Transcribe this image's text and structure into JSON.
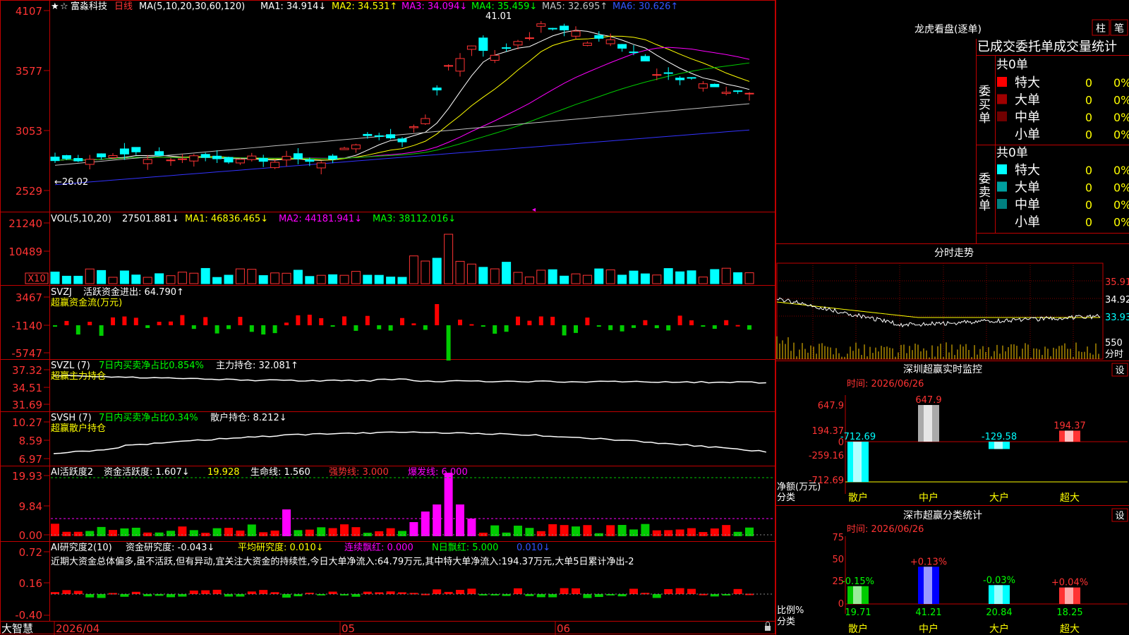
{
  "main": {
    "stock_name": "富淼科技",
    "period": "日线",
    "ma_prefix": "MA(5,10,20,30,60,120)",
    "ma_items": [
      {
        "text": "MA1: 34.914↓",
        "color": "#ffffff"
      },
      {
        "text": "MA2: 34.531↑",
        "color": "#ffff00"
      },
      {
        "text": "MA3: 34.094↓",
        "color": "#ff00ff"
      },
      {
        "text": "MA4: 35.459↓",
        "color": "#00ff00"
      },
      {
        "text": "MA5: 32.695↑",
        "color": "#c0c0c0"
      },
      {
        "text": "MA6: 30.626↑",
        "color": "#3333ff"
      }
    ],
    "price_ticks": [
      "4107",
      "3577",
      "3053",
      "2529"
    ],
    "high_label": "41.01",
    "low_label": "←26.02",
    "date_labels": [
      "2026/04",
      "05",
      "06"
    ]
  },
  "volume": {
    "title": "VOL(5,10,20)",
    "value": "27501.881↓",
    "ma1": "MA1: 46836.465↓",
    "ma2": "MA2: 44181.941↓",
    "ma3": "MA3: 38112.016↓",
    "ticks": [
      "21240",
      "10489"
    ],
    "unit": "X10"
  },
  "svzj": {
    "title": "SVZJ",
    "line1": "活跃资金进出: 64.790↑",
    "line2": "超赢资金流(万元)",
    "ticks": [
      "3467",
      "-1140",
      "-5747"
    ]
  },
  "svzl": {
    "title": "SVZL (7)",
    "pct": "7日内买卖净占比0.854%",
    "pos": "主力持仓: 32.081↑",
    "line2": "超赢主力持仓",
    "ticks": [
      "37.32",
      "34.51",
      "31.69"
    ]
  },
  "svsh": {
    "title": "SVSH (7)",
    "pct": "7日内买卖净占比0.34%",
    "pos": "散户持仓: 8.212↓",
    "line2": "超赢散户持仓",
    "ticks": [
      "10.27",
      "8.59",
      "6.97"
    ]
  },
  "ai1": {
    "title": "AI活跃度2",
    "act": "资金活跃度: 1.607↓",
    "v2": "19.928",
    "life": "生命线: 1.560",
    "strong": "强势线: 3.000",
    "burst": "爆发线: 6.000",
    "ticks": [
      "19.93",
      "9.84",
      "0.00"
    ]
  },
  "ai2": {
    "title": "AI研究度2(10)",
    "research": "资金研究度: -0.043↓",
    "avg": "平均研究度: 0.010↓",
    "lianxu": "连续飘红: 0.000",
    "nday": "N日飘红: 5.000",
    "v5": "0.010↓",
    "comment": "近期大资金总体偏多,虽不活跃,但有异动,宜关注大资金的持续性,今日大单净流入:64.79万元,其中特大单净流入:194.37万元,大单5日累计净出-2",
    "ticks": [
      "0.72",
      "0.16",
      "-0.40"
    ]
  },
  "bottom": {
    "brand": "大智慧"
  },
  "lhb": {
    "title": "龙虎看盘(逐单)",
    "btn1": "柱",
    "btn2": "笔",
    "header": "已成交委托单成交量统计",
    "buy_label": "委买单",
    "sell_label": "委卖单",
    "buy_total": "共0单",
    "sell_total": "共0单",
    "buy_rows": [
      {
        "name": "特大",
        "count": "0",
        "pct": "0%",
        "color": "#ff0000"
      },
      {
        "name": "大单",
        "count": "0",
        "pct": "0%",
        "color": "#a00000"
      },
      {
        "name": "中单",
        "count": "0",
        "pct": "0%",
        "color": "#700000"
      },
      {
        "name": "小单",
        "count": "0",
        "pct": "0%",
        "color": ""
      }
    ],
    "sell_rows": [
      {
        "name": "特大",
        "count": "0",
        "pct": "0%",
        "color": "#00ffff"
      },
      {
        "name": "大单",
        "count": "0",
        "pct": "0%",
        "color": "#00a0a0"
      },
      {
        "name": "中单",
        "count": "0",
        "pct": "0%",
        "color": "#008080"
      },
      {
        "name": "小单",
        "count": "0",
        "pct": "0%",
        "color": ""
      }
    ]
  },
  "intraday": {
    "title": "分时走势",
    "price_ticks": [
      "35.91",
      "34.92",
      "33.93"
    ],
    "vol_tick": "550",
    "vol_label": "分时"
  },
  "monitor": {
    "title": "深圳超赢实时监控",
    "settings": "设",
    "time": "时间: 2026/06/26",
    "yticks": [
      "647.9",
      "194.37",
      "0",
      "-259.16",
      "-712.69"
    ],
    "ylabel1": "净额(万元)",
    "ylabel2": "分类",
    "categories": [
      "散户",
      "中户",
      "大户",
      "超大"
    ],
    "values": [
      -712.69,
      647.9,
      -129.58,
      194.37
    ],
    "value_labels": [
      "-712.69",
      "647.9",
      "-129.58",
      "194.37"
    ]
  },
  "stats": {
    "title": "深市超赢分类统计",
    "settings": "设",
    "time": "时间: 2026/06/26",
    "yticks": [
      "75",
      "50",
      "25",
      "0"
    ],
    "ylabel1": "比例%",
    "ylabel2": "分类",
    "categories": [
      "散户",
      "中户",
      "大户",
      "超大"
    ],
    "values": [
      19.71,
      41.21,
      20.84,
      18.25
    ],
    "value_labels": [
      "19.71",
      "41.21",
      "20.84",
      "18.25"
    ],
    "deltas": [
      "-0.15%",
      "+0.13%",
      "-0.03%",
      "+0.04%"
    ],
    "delta_colors": [
      "#00ff00",
      "#ff3333",
      "#00ff00",
      "#ff3333"
    ]
  }
}
